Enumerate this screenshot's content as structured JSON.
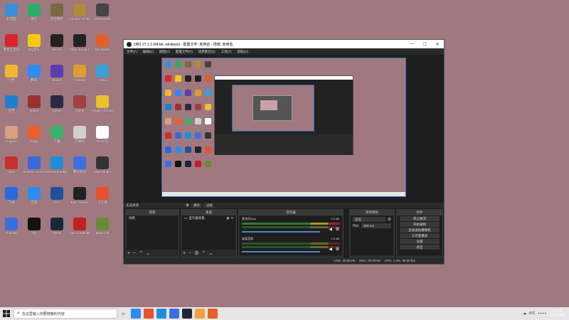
{
  "desktop": {
    "icons": [
      {
        "label": "此电脑",
        "color": "#3b8fd9"
      },
      {
        "label": "微信",
        "color": "#2aae67"
      },
      {
        "label": "反恐精英",
        "color": "#7a6a40"
      },
      {
        "label": "Counter-Strike",
        "color": "#b08a3a"
      },
      {
        "label": "Dishonored",
        "color": "#444444"
      },
      {
        "label": "网易云音乐",
        "color": "#d8262a"
      },
      {
        "label": "QQ音乐",
        "color": "#f6c90e"
      },
      {
        "label": "Hitman",
        "color": "#222222"
      },
      {
        "label": "Metro Exodus",
        "color": "#222222"
      },
      {
        "label": "Tab Master",
        "color": "#e0602a"
      },
      {
        "label": "文档",
        "color": "#f2b630"
      },
      {
        "label": "腾讯",
        "color": "#2d8cf0"
      },
      {
        "label": "Ubisoft",
        "color": "#5a3db0"
      },
      {
        "label": "Victoria",
        "color": "#d8a030"
      },
      {
        "label": "Lutris",
        "color": "#3aa0d8"
      },
      {
        "label": "应用",
        "color": "#1e7fd0"
      },
      {
        "label": "Mount",
        "color": "#9a3030"
      },
      {
        "label": "Steam",
        "color": "#2a2a40"
      },
      {
        "label": "Game",
        "color": "#a04040"
      },
      {
        "label": "Google Chrome",
        "color": "#e8c030"
      },
      {
        "label": "Kingdom",
        "color": "#d8a080"
      },
      {
        "label": "Origin",
        "color": "#e8602a"
      },
      {
        "label": "下载",
        "color": "#3ab06a"
      },
      {
        "label": "回收站",
        "color": "#d0d0d0"
      },
      {
        "label": "Genshin",
        "color": "#ffffff"
      },
      {
        "label": "Apex",
        "color": "#c83030"
      },
      {
        "label": "Ubisoft Connect",
        "color": "#3a6ad8"
      },
      {
        "label": "Microsoft Edge",
        "color": "#1f8fd8"
      },
      {
        "label": "腾讯会议",
        "color": "#3a70e0"
      },
      {
        "label": "OBS Studio",
        "color": "#333333"
      },
      {
        "label": "飞书",
        "color": "#2a6ae0"
      },
      {
        "label": "迅雷",
        "color": "#2d8cf0"
      },
      {
        "label": "Arc",
        "color": "#2050a0"
      },
      {
        "label": "Epic Games",
        "color": "#222222"
      },
      {
        "label": "小工具",
        "color": "#e85030"
      },
      {
        "label": "Counter",
        "color": "#3a70e0"
      },
      {
        "label": "QQ",
        "color": "#111111"
      },
      {
        "label": "Steam",
        "color": "#1b2838"
      },
      {
        "label": "Apex Legends",
        "color": "#c02020"
      },
      {
        "label": "Minecraft",
        "color": "#6a8a3a"
      }
    ]
  },
  "obs": {
    "title": "OBS 27.1.3 (64-bit, windows) - 配置文件: 未命名 - 场景: 未命名",
    "window_buttons": [
      "—",
      "☐",
      "✕"
    ],
    "menus": [
      "文件(F)",
      "编辑(E)",
      "视图(V)",
      "配置文件(P)",
      "场景集合(S)",
      "工具(T)",
      "帮助(H)"
    ],
    "scene_bar": {
      "label": "未选择源",
      "props": "属性",
      "filter": "滤镜"
    },
    "docks": {
      "scenes": {
        "title": "场景",
        "items": [
          "场景"
        ]
      },
      "sources": {
        "title": "来源",
        "items": [
          "显示器采集"
        ]
      },
      "mixer": {
        "title": "混音器",
        "channels": [
          {
            "name": "麦克风/Aux",
            "db": "0.0 dB"
          },
          {
            "name": "桌面音频",
            "db": "0.0 dB"
          }
        ]
      },
      "transitions": {
        "title": "转场特效",
        "type": "淡化",
        "duration_label": "时长",
        "duration": "300 ms"
      },
      "controls": {
        "title": "控件",
        "buttons": [
          "停止推流",
          "开始录制",
          "启动虚拟摄像机",
          "工作室模式",
          "设置",
          "退出"
        ]
      }
    },
    "status": {
      "live": "LIVE: 00:00:00",
      "rec": "REC: 00:00:00",
      "cpu": "CPU: 1.3%, 30.00 fps"
    }
  },
  "taskbar": {
    "search_placeholder": "在这里输入你要搜索的内容",
    "apps": [
      {
        "color": "#2d8cf0"
      },
      {
        "color": "#e85030"
      },
      {
        "color": "#1f8fd8"
      },
      {
        "color": "#3a70e0"
      },
      {
        "color": "#1b2838"
      },
      {
        "color": "#f2a040"
      },
      {
        "color": "#e8602a"
      }
    ],
    "weather": "6°C",
    "time": "20:58",
    "date": "2021/12/8"
  }
}
